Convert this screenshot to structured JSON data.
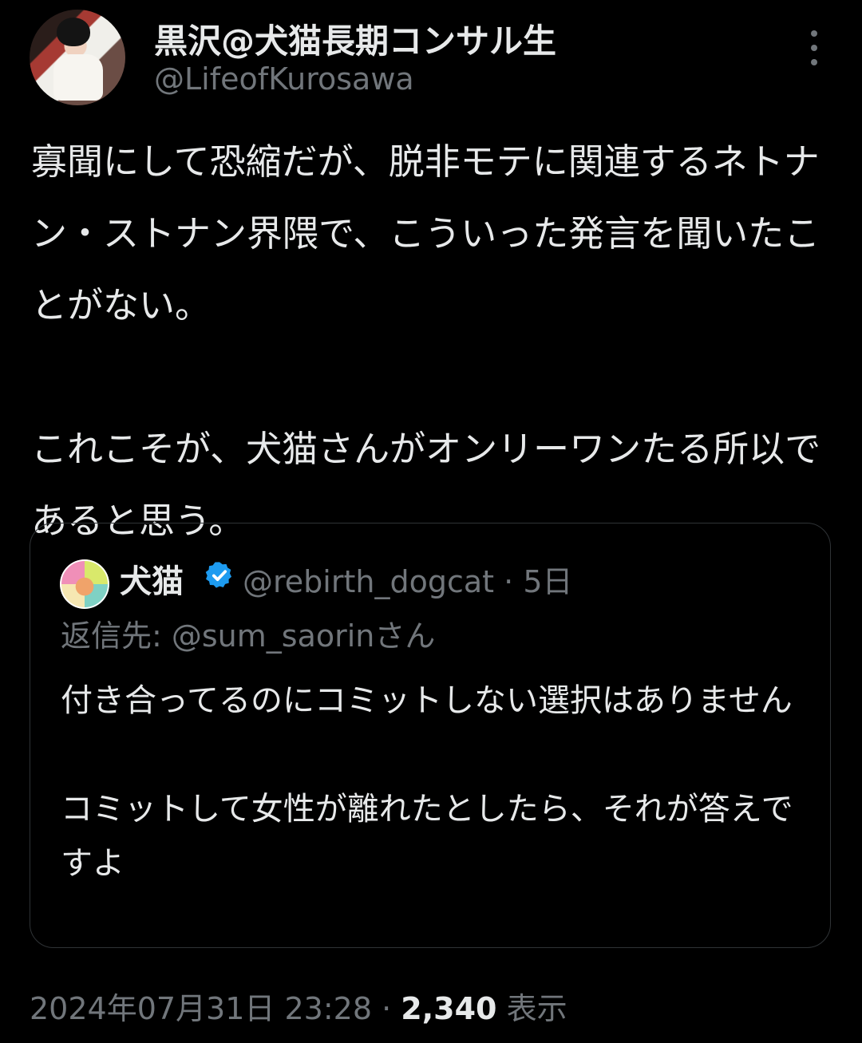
{
  "author": {
    "display_name": "黒沢@犬猫長期コンサル生",
    "handle": "@LifeofKurosawa"
  },
  "tweet": {
    "text": "寡聞にして恐縮だが、脱非モテに関連するネトナン・ストナン界隈で、こういった発言を聞いたことがない。\n\nこれこそが、犬猫さんがオンリーワンたる所以であると思う。"
  },
  "quoted_tweet": {
    "display_name": "犬猫",
    "handle": "@rebirth_dogcat",
    "separator": "·",
    "age": "5日",
    "reply_to": "返信先: @sum_saorinさん",
    "text": "付き合ってるのにコミットしない選択はありません\n\nコミットして女性が離れたとしたら、それが答えですよ",
    "verified_color": "#1d9bf0"
  },
  "footer": {
    "timestamp": "2024年07月31日 23:28",
    "separator": "·",
    "views_count": "2,340",
    "views_label": "表示"
  }
}
